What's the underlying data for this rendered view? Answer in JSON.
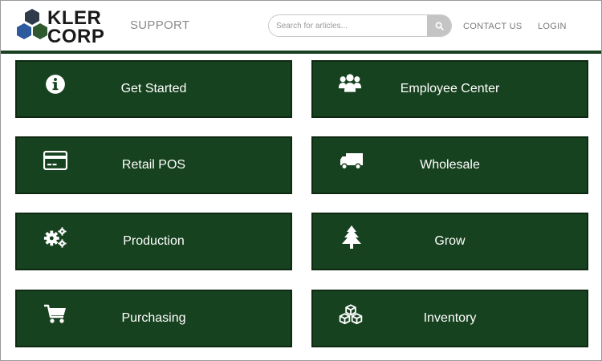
{
  "brand": {
    "line1": "KLER",
    "line2": "CORP",
    "hex_colors": [
      "#2f3a4a",
      "#2d5a9e",
      "#2f5a2f"
    ]
  },
  "header": {
    "support_label": "SUPPORT",
    "search_placeholder": "Search for articles...",
    "search_icon": "search-icon",
    "contact_label": "CONTACT US",
    "login_label": "LOGIN"
  },
  "colors": {
    "accent_green": "#17421f",
    "tile_border": "#0d2912",
    "tile_text": "#ffffff"
  },
  "tiles": [
    {
      "label": "Get Started",
      "icon": "info-icon"
    },
    {
      "label": "Employee Center",
      "icon": "users-icon"
    },
    {
      "label": "Retail POS",
      "icon": "credit-card-icon"
    },
    {
      "label": "Wholesale",
      "icon": "truck-icon"
    },
    {
      "label": "Production",
      "icon": "gears-icon"
    },
    {
      "label": "Grow",
      "icon": "tree-icon"
    },
    {
      "label": "Purchasing",
      "icon": "cart-icon"
    },
    {
      "label": "Inventory",
      "icon": "boxes-icon"
    }
  ]
}
